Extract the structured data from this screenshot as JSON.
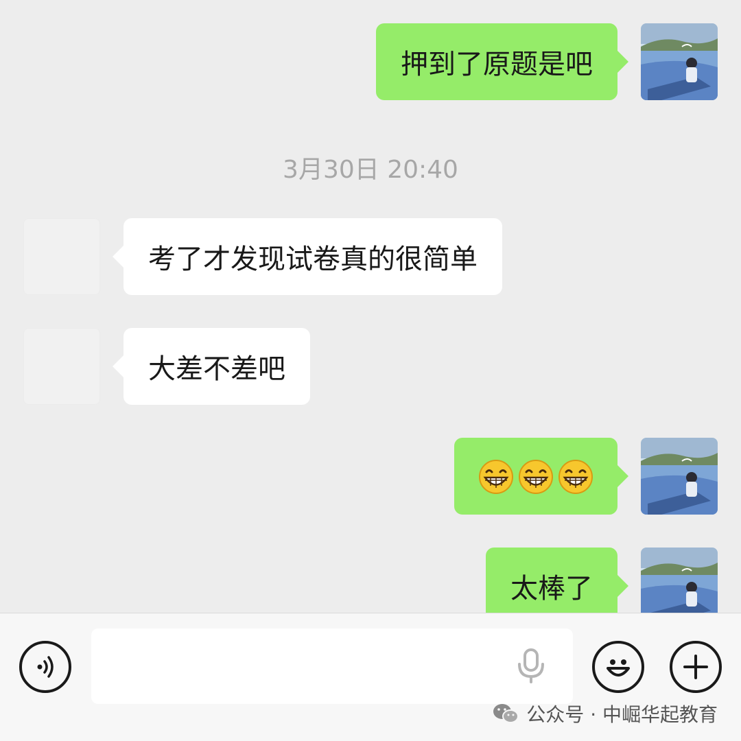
{
  "chat": {
    "messages": [
      {
        "id": "m1",
        "side": "out",
        "text": "押到了原题是吧"
      },
      {
        "id": "m2",
        "side": "in",
        "text": "考了才发现试卷真的很简单"
      },
      {
        "id": "m3",
        "side": "in",
        "text": "大差不差吧"
      },
      {
        "id": "m4",
        "side": "out",
        "emojis": [
          "grin-face",
          "grin-face",
          "grin-face"
        ]
      },
      {
        "id": "m5",
        "side": "out",
        "text": "太棒了"
      }
    ],
    "timestamp": "3月30日 20:40"
  },
  "inputbar": {
    "voice_icon": "voice-icon",
    "field_value": "",
    "mic_icon": "mic-icon",
    "emoji_icon": "smile-icon",
    "plus_icon": "plus-icon"
  },
  "watermark": {
    "icon": "wechat-icon",
    "text": "公众号 · 中崛华起教育"
  },
  "colors": {
    "out_bubble": "#95ec69",
    "in_bubble": "#ffffff",
    "background": "#ededed"
  }
}
